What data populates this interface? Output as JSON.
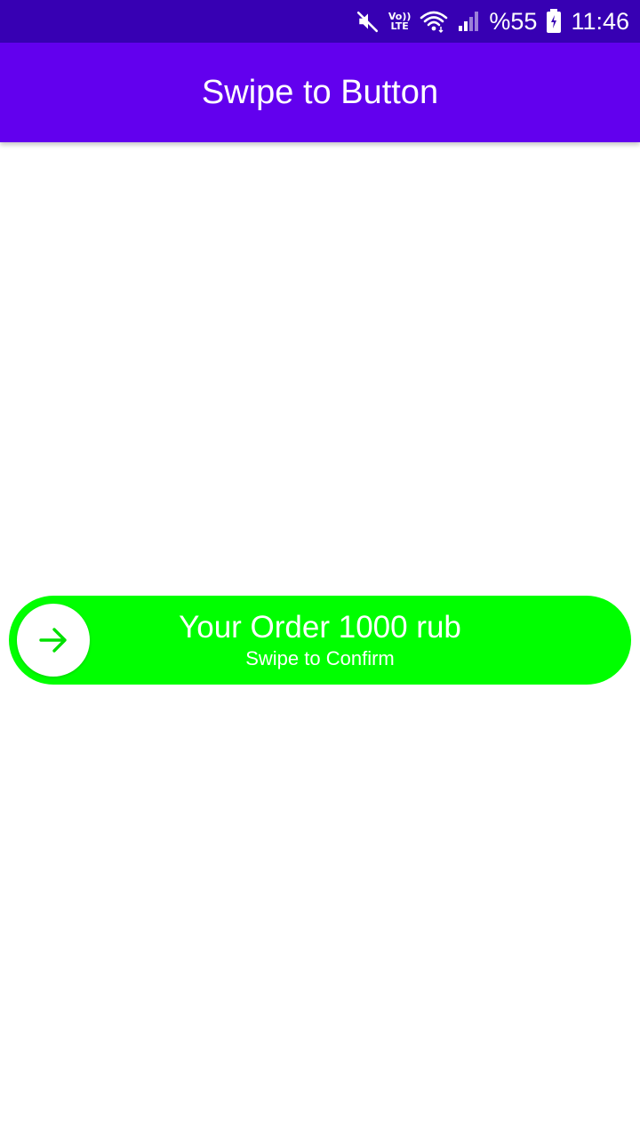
{
  "status_bar": {
    "icons": [
      "mute-icon",
      "volte-icon",
      "wifi-icon",
      "signal-icon",
      "battery-icon"
    ],
    "lte_top": "Vo))",
    "lte_bottom": "LTE",
    "battery_percent": "%55",
    "time": "11:46"
  },
  "app_bar": {
    "title": "Swipe to Button",
    "color": "#6200EE"
  },
  "swipe_button": {
    "title": "Your Order 1000 rub",
    "subtitle": "Swipe to Confirm",
    "color": "#00FF00",
    "knob_icon": "arrow-right-icon"
  },
  "colors": {
    "status_bar": "#3700B3",
    "background": "#FFFFFF"
  }
}
